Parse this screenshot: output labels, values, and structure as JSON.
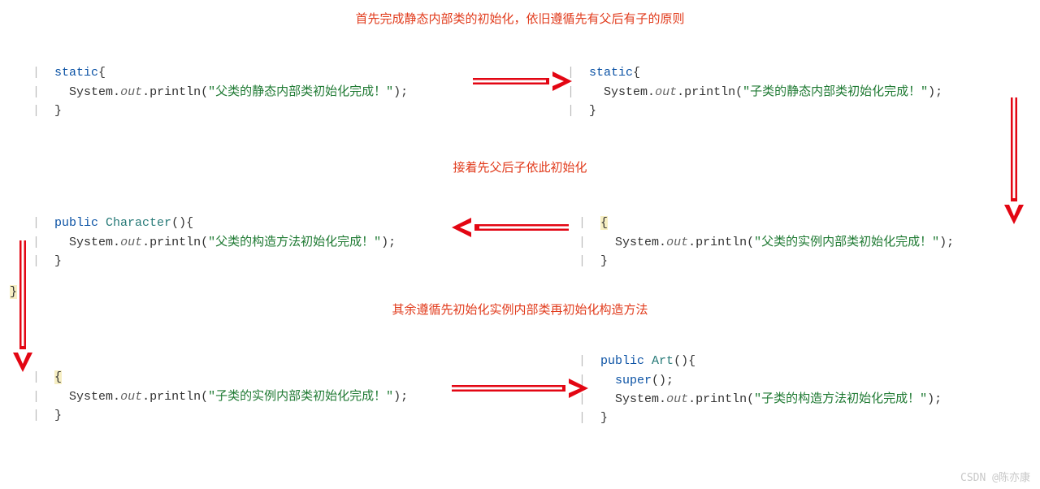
{
  "captions": {
    "top": "首先完成静态内部类的初始化，依旧遵循先有父后有子的原则",
    "mid": "接着先父后子依此初始化",
    "bot": "其余遵循先初始化实例内部类再初始化构造方法"
  },
  "code": {
    "static_kw": "static",
    "open": "{",
    "close": "}",
    "system": "System",
    "dot": ".",
    "out_field": "out",
    "println": "println",
    "paren_open": "(",
    "paren_close_semi": ");",
    "semi": ";",
    "public_kw": "public",
    "super_call": "super",
    "class_character": "Character",
    "class_art": "Art",
    "ctor_paren": "(){",
    "ctor_close_paren": "();",
    "msg_parent_static": "\"父类的静态内部类初始化完成！\"",
    "msg_child_static": "\"子类的静态内部类初始化完成！\"",
    "msg_parent_ctor": "\"父类的构造方法初始化完成！\"",
    "msg_parent_instance": "\"父类的实例内部类初始化完成！\"",
    "msg_child_instance": "\"子类的实例内部类初始化完成！\"",
    "msg_child_ctor": "\"子类的构造方法初始化完成！\""
  },
  "watermark": "CSDN @陈亦康",
  "colors": {
    "annotation_red": "#e13b1c",
    "arrow_red": "#e30613"
  }
}
